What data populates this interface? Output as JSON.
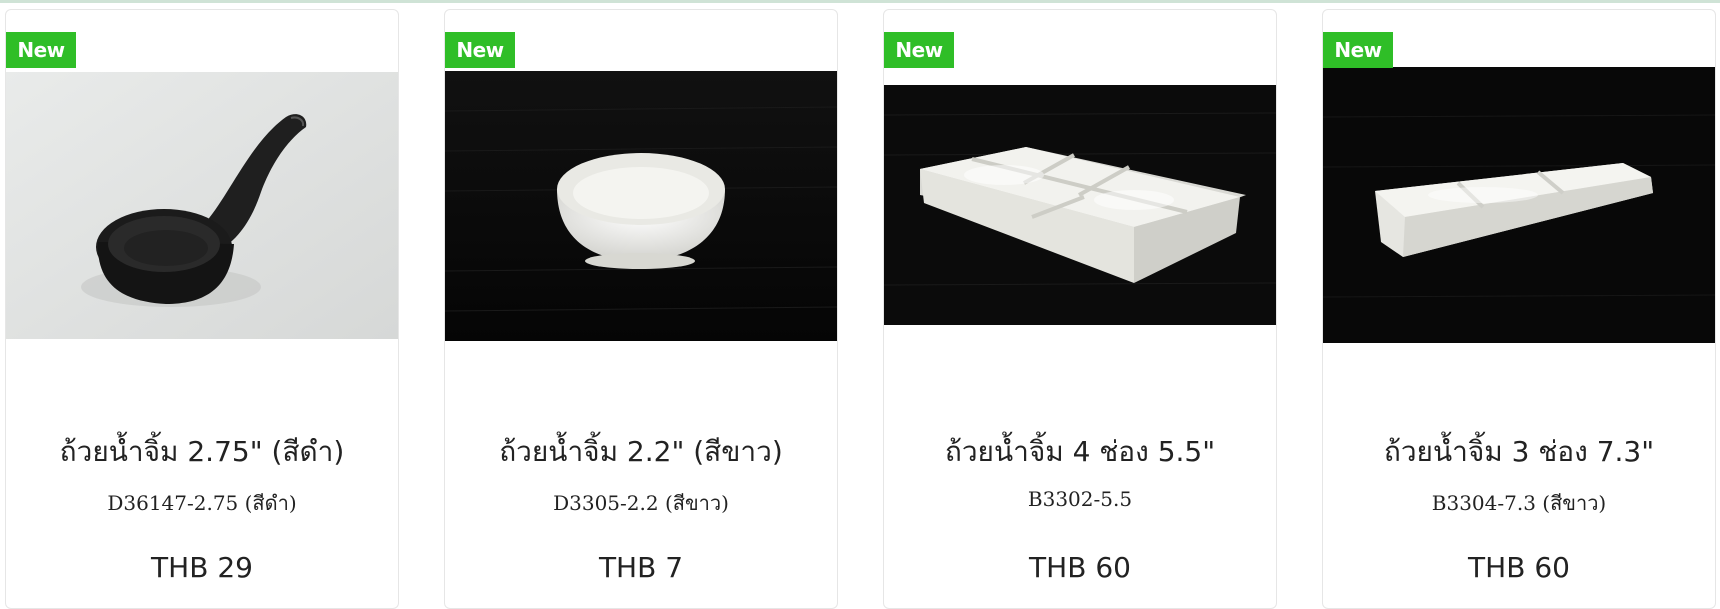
{
  "products": [
    {
      "badge": "New",
      "name": "ถ้วยน้ำจิ้ม 2.75\" (สีดำ)",
      "sku": "D36147-2.75 (สีดำ)",
      "price": "THB 29",
      "image": "black-sauce-spoon-cup-photo"
    },
    {
      "badge": "New",
      "name": "ถ้วยน้ำจิ้ม 2.2\" (สีขาว)",
      "sku": "D3305-2.2 (สีขาว)",
      "price": "THB 7",
      "image": "white-sauce-bowl-photo"
    },
    {
      "badge": "New",
      "name": "ถ้วยน้ำจิ้ม 4 ช่อง 5.5\"",
      "sku": "B3302-5.5",
      "price": "THB 60",
      "image": "white-4-compartment-dish-photo"
    },
    {
      "badge": "New",
      "name": "ถ้วยน้ำจิ้ม 3 ช่อง 7.3\"",
      "sku": "B3304-7.3 (สีขาว)",
      "price": "THB 60",
      "image": "white-3-compartment-dish-photo"
    }
  ],
  "colors": {
    "badge_bg": "#2fbe27",
    "badge_text": "#ffffff",
    "text": "#222222",
    "card_border": "#e6e6e6"
  }
}
